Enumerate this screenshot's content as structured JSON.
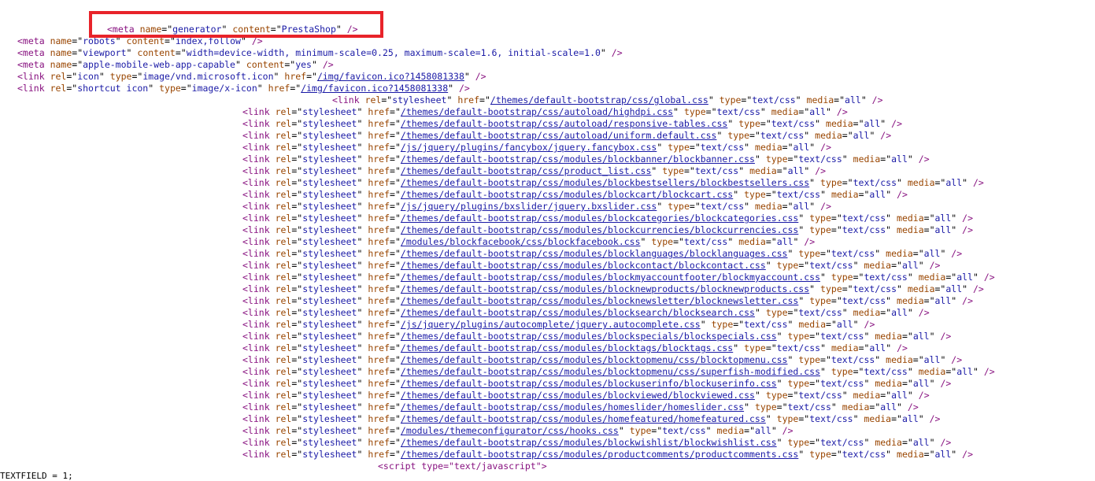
{
  "head_lines": [
    {
      "indent": 136,
      "tag": "meta",
      "attrs": [
        [
          "name",
          "generator",
          false
        ],
        [
          "content",
          "PrestaShop",
          false
        ]
      ]
    },
    {
      "indent": 22,
      "tag": "meta",
      "attrs": [
        [
          "name",
          "robots",
          false
        ],
        [
          "content",
          "index,follow",
          false
        ]
      ]
    },
    {
      "indent": 22,
      "tag": "meta",
      "attrs": [
        [
          "name",
          "viewport",
          false
        ],
        [
          "content",
          "width=device-width, minimum-scale=0.25, maximum-scale=1.6, initial-scale=1.0",
          false
        ]
      ]
    },
    {
      "indent": 22,
      "tag": "meta",
      "attrs": [
        [
          "name",
          "apple-mobile-web-app-capable",
          false
        ],
        [
          "content",
          "yes",
          false
        ]
      ]
    },
    {
      "indent": 22,
      "tag": "link",
      "attrs": [
        [
          "rel",
          "icon",
          false
        ],
        [
          "type",
          "image/vnd.microsoft.icon",
          false
        ],
        [
          "href",
          "/img/favicon.ico?1458081338",
          true
        ]
      ]
    },
    {
      "indent": 22,
      "tag": "link",
      "attrs": [
        [
          "rel",
          "shortcut icon",
          false
        ],
        [
          "type",
          "image/x-icon",
          false
        ],
        [
          "href",
          "/img/favicon.ico?1458081338",
          true
        ]
      ]
    }
  ],
  "stylesheets": [
    "/themes/default-bootstrap/css/global.css",
    "/themes/default-bootstrap/css/autoload/highdpi.css",
    "/themes/default-bootstrap/css/autoload/responsive-tables.css",
    "/themes/default-bootstrap/css/autoload/uniform.default.css",
    "/js/jquery/plugins/fancybox/jquery.fancybox.css",
    "/themes/default-bootstrap/css/modules/blockbanner/blockbanner.css",
    "/themes/default-bootstrap/css/product_list.css",
    "/themes/default-bootstrap/css/modules/blockbestsellers/blockbestsellers.css",
    "/themes/default-bootstrap/css/modules/blockcart/blockcart.css",
    "/js/jquery/plugins/bxslider/jquery.bxslider.css",
    "/themes/default-bootstrap/css/modules/blockcategories/blockcategories.css",
    "/themes/default-bootstrap/css/modules/blockcurrencies/blockcurrencies.css",
    "/modules/blockfacebook/css/blockfacebook.css",
    "/themes/default-bootstrap/css/modules/blocklanguages/blocklanguages.css",
    "/themes/default-bootstrap/css/modules/blockcontact/blockcontact.css",
    "/themes/default-bootstrap/css/modules/blockmyaccountfooter/blockmyaccount.css",
    "/themes/default-bootstrap/css/modules/blocknewproducts/blocknewproducts.css",
    "/themes/default-bootstrap/css/modules/blocknewsletter/blocknewsletter.css",
    "/themes/default-bootstrap/css/modules/blocksearch/blocksearch.css",
    "/js/jquery/plugins/autocomplete/jquery.autocomplete.css",
    "/themes/default-bootstrap/css/modules/blockspecials/blockspecials.css",
    "/themes/default-bootstrap/css/modules/blocktags/blocktags.css",
    "/themes/default-bootstrap/css/modules/blocktopmenu/css/blocktopmenu.css",
    "/themes/default-bootstrap/css/modules/blocktopmenu/css/superfish-modified.css",
    "/themes/default-bootstrap/css/modules/blockuserinfo/blockuserinfo.css",
    "/themes/default-bootstrap/css/modules/blockviewed/blockviewed.css",
    "/themes/default-bootstrap/css/modules/homeslider/homeslider.css",
    "/themes/default-bootstrap/css/modules/homefeatured/homefeatured.css",
    "/modules/themeconfigurator/css/hooks.css",
    "/themes/default-bootstrap/css/modules/blockwishlist/blockwishlist.css",
    "/themes/default-bootstrap/css/modules/productcomments/productcomments.css"
  ],
  "stylesheet_type": "text/css",
  "stylesheet_media": "all",
  "script_tag": "<script type=\"text/javascript\">",
  "truncated_bottom_text": "TEXTFIELD = 1;",
  "highlight_color": "#e8232a"
}
